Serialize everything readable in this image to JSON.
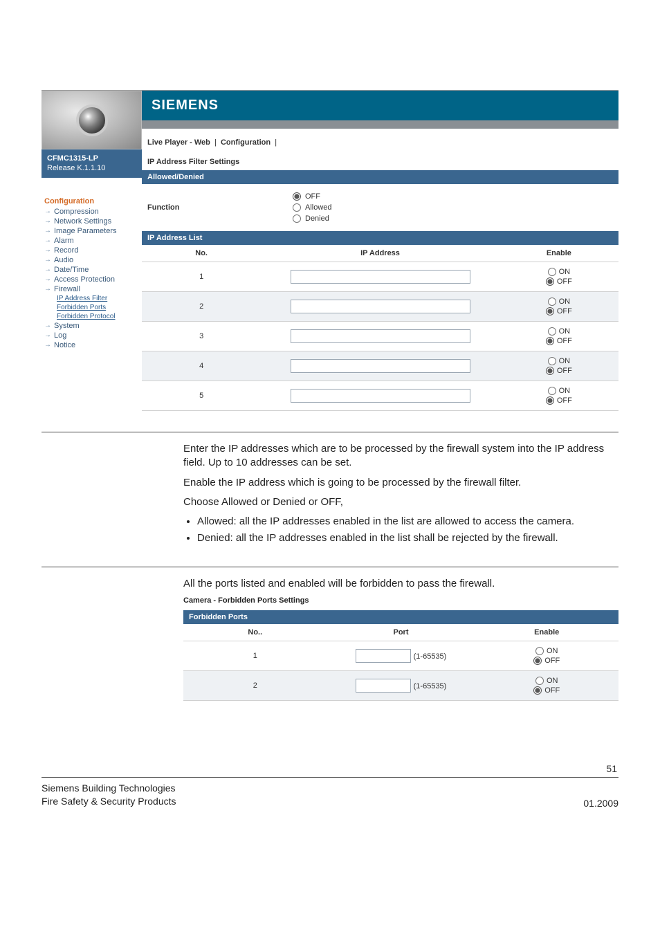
{
  "sidebar": {
    "product": "CFMC1315-LP",
    "release": "Release K.1.1.10",
    "heading": "Configuration",
    "items": [
      "Compression",
      "Network Settings",
      "Image Parameters",
      "Alarm",
      "Record",
      "Audio",
      "Date/Time",
      "Access Protection",
      "Firewall"
    ],
    "firewall_sub": [
      "IP Address Filter",
      "Forbidden Ports",
      "Forbidden Protocol"
    ],
    "items_after": [
      "System",
      "Log",
      "Notice"
    ]
  },
  "header": {
    "brand": "SIEMENS",
    "breadcrumb_a": "Live Player - Web",
    "breadcrumb_b": "Configuration"
  },
  "ipfilter": {
    "title": "IP Address Filter Settings",
    "panel1": "Allowed/Denied",
    "function_label": "Function",
    "opts": {
      "off": "OFF",
      "allowed": "Allowed",
      "denied": "Denied"
    },
    "panel2": "IP Address List",
    "cols": {
      "no": "No.",
      "ip": "IP Address",
      "enable": "Enable"
    },
    "on": "ON",
    "off": "OFF",
    "rows": [
      {
        "no": "1",
        "ip": "",
        "enable": "OFF"
      },
      {
        "no": "2",
        "ip": "",
        "enable": "OFF"
      },
      {
        "no": "3",
        "ip": "",
        "enable": "OFF"
      },
      {
        "no": "4",
        "ip": "",
        "enable": "OFF"
      },
      {
        "no": "5",
        "ip": "",
        "enable": "OFF"
      }
    ]
  },
  "doc1": {
    "p1": "Enter the IP addresses which are to be processed by the firewall system into the IP address field. Up to 10 addresses can be set.",
    "p2": "Enable the IP address which is going to be processed by the firewall filter.",
    "p3": "Choose Allowed or Denied or OFF,",
    "li1": "Allowed: all the IP addresses enabled in the list are allowed to access the camera.",
    "li2": "Denied: all the IP addresses enabled in the list shall be rejected by the firewall."
  },
  "doc2": {
    "p1": "All the ports listed and enabled will be forbidden to pass the firewall.",
    "caption": "Camera - Forbidden Ports Settings"
  },
  "ports": {
    "panel": "Forbidden Ports",
    "cols": {
      "no": "No..",
      "port": "Port",
      "enable": "Enable"
    },
    "range": "(1-65535)",
    "on": "ON",
    "off": "OFF",
    "rows": [
      {
        "no": "1",
        "port": "",
        "enable": "OFF"
      },
      {
        "no": "2",
        "port": "",
        "enable": "OFF"
      }
    ]
  },
  "footer": {
    "page": "51",
    "line1": "Siemens Building Technologies",
    "line2": "Fire Safety & Security Products",
    "date": "01.2009"
  }
}
